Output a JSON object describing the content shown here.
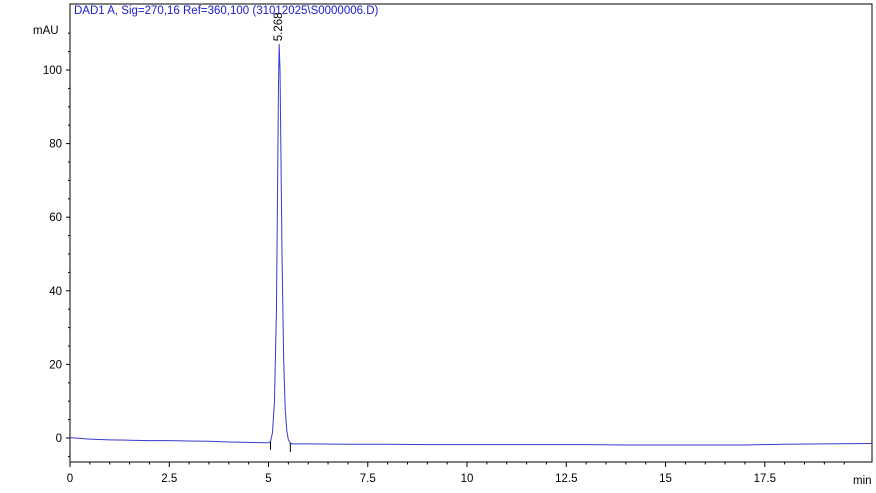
{
  "chart_data": {
    "type": "line",
    "title": "DAD1 A, Sig=270,16 Ref=360,100 (31012025\\S0000006.D)",
    "ylabel": "mAU",
    "xlabel": "min",
    "xlim": [
      0,
      20.2
    ],
    "ylim": [
      -7,
      115
    ],
    "x_ticks": [
      0,
      2.5,
      5,
      7.5,
      10,
      12.5,
      15,
      17.5
    ],
    "x_tick_labels": [
      "0",
      "2.5",
      "5",
      "7.5",
      "10",
      "12.5",
      "15",
      "17.5"
    ],
    "y_ticks": [
      0,
      20,
      40,
      60,
      80,
      100
    ],
    "y_tick_labels": [
      "0",
      "20",
      "40",
      "60",
      "80",
      "100"
    ],
    "grid": false,
    "colors": {
      "trace": "#3a3acc",
      "title": "#1a1ad0",
      "axes": "#000000"
    },
    "peaks": [
      {
        "label": "5.268",
        "x": 5.268,
        "y": 107
      }
    ],
    "series": [
      {
        "x": [
          0,
          0.5,
          1,
          1.5,
          2,
          2.5,
          3,
          3.5,
          4,
          4.5,
          4.9,
          5.0,
          5.05,
          5.1,
          5.15,
          5.2,
          5.23,
          5.25,
          5.268,
          5.29,
          5.31,
          5.34,
          5.38,
          5.42,
          5.46,
          5.5,
          5.55,
          5.6,
          6,
          7,
          8,
          9,
          10,
          11,
          12,
          13,
          14,
          15,
          16,
          17,
          17.5,
          18,
          19,
          20.2
        ],
        "y": [
          0.1,
          -0.3,
          -0.5,
          -0.6,
          -0.7,
          -0.7,
          -0.8,
          -0.9,
          -1.1,
          -1.2,
          -1.3,
          -1.3,
          -1.0,
          1.5,
          10,
          35,
          70,
          95,
          107,
          100,
          80,
          50,
          22,
          8,
          2,
          -0.5,
          -1.4,
          -1.6,
          -1.6,
          -1.7,
          -1.7,
          -1.8,
          -1.8,
          -1.8,
          -1.8,
          -1.8,
          -1.9,
          -1.9,
          -1.9,
          -1.9,
          -1.8,
          -1.7,
          -1.6,
          -1.5
        ]
      }
    ]
  }
}
